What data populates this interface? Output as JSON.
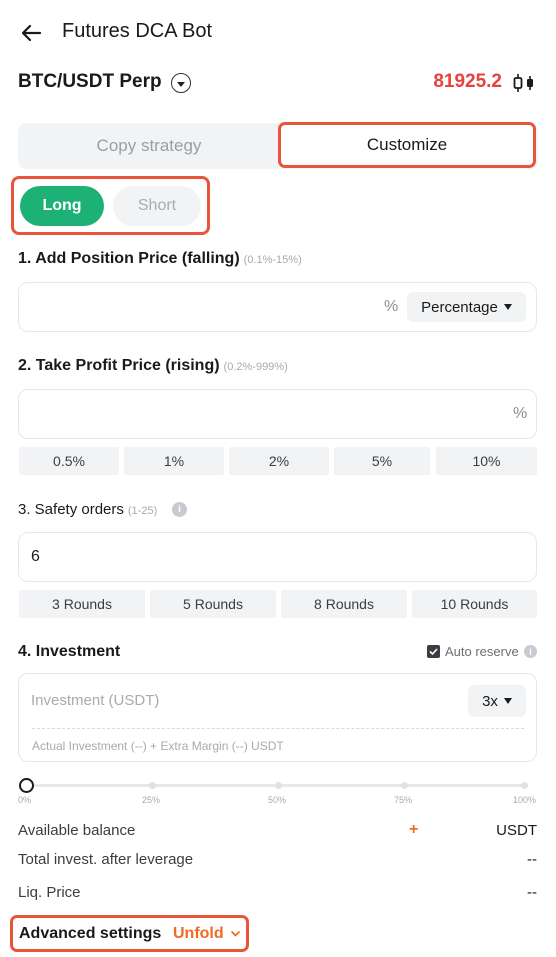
{
  "header": {
    "title": "Futures DCA Bot"
  },
  "pair": {
    "name": "BTC/USDT Perp",
    "price": "81925.2"
  },
  "mode_tabs": {
    "copy": "Copy strategy",
    "customize": "Customize",
    "active": "Customize"
  },
  "direction": {
    "long": "Long",
    "short": "Short",
    "active": "Long"
  },
  "add_position": {
    "label": "1. Add Position Price (falling)",
    "hint": "(0.1%-15%)",
    "value": "",
    "unit": "%",
    "select": "Percentage"
  },
  "take_profit": {
    "label": "2. Take Profit Price (rising)",
    "hint": "(0.2%-999%)",
    "value": "",
    "unit": "%",
    "presets": [
      "0.5%",
      "1%",
      "2%",
      "5%",
      "10%"
    ]
  },
  "safety_orders": {
    "label": "3. Safety orders",
    "hint": "(1-25)",
    "value": "6",
    "presets": [
      "3 Rounds",
      "5 Rounds",
      "8 Rounds",
      "10 Rounds"
    ]
  },
  "investment": {
    "label": "4. Investment",
    "auto_reserve": "Auto reserve",
    "auto_reserve_checked": true,
    "placeholder": "Investment (USDT)",
    "leverage": "3x",
    "note": "Actual Investment (--) + Extra Margin  (--) USDT",
    "slider_percent": 0,
    "ticks": [
      "0%",
      "25%",
      "50%",
      "75%",
      "100%"
    ]
  },
  "summary": {
    "available_label": "Available balance",
    "available_unit": "USDT",
    "total_label": "Total invest. after leverage",
    "total_value": "--",
    "liq_label": "Liq. Price",
    "liq_value": "--"
  },
  "advanced": {
    "label": "Advanced settings",
    "toggle": "Unfold"
  },
  "colors": {
    "accent_green": "#1eb176",
    "price_red": "#e8413c",
    "highlight": "#e8553a",
    "link_orange": "#f06a24"
  }
}
